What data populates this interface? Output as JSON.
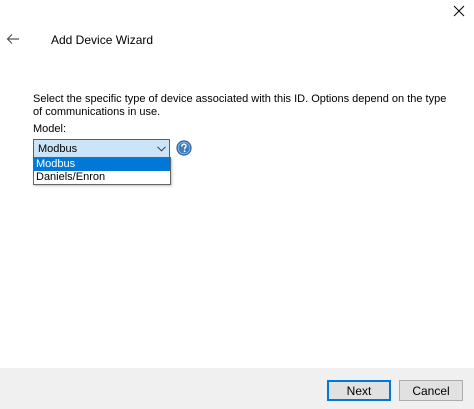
{
  "window": {
    "title": "Add Device Wizard"
  },
  "content": {
    "description": "Select the specific type of device associated with this ID. Options depend on the type of communications in use.",
    "model_label": "Model:",
    "model_selected": "Modbus",
    "model_options": [
      "Modbus",
      "Daniels/Enron"
    ]
  },
  "footer": {
    "next_label": "Next",
    "cancel_label": "Cancel"
  },
  "colors": {
    "accent": "#0078d7",
    "help_icon": "#3c7fc0"
  }
}
